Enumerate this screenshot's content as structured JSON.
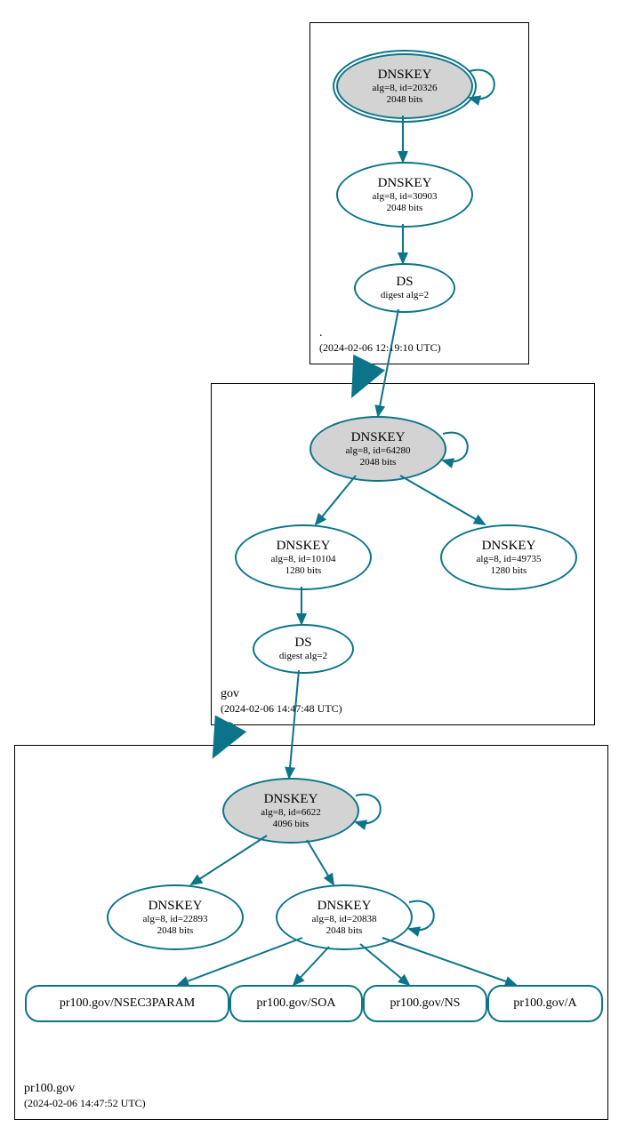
{
  "zones": {
    "root": {
      "name": ".",
      "timestamp": "(2024-02-06 12:19:10 UTC)"
    },
    "gov": {
      "name": "gov",
      "timestamp": "(2024-02-06 14:47:48 UTC)"
    },
    "pr100": {
      "name": "pr100.gov",
      "timestamp": "(2024-02-06 14:47:52 UTC)"
    }
  },
  "nodes": {
    "root_ksk": {
      "title": "DNSKEY",
      "line1": "alg=8, id=20326",
      "line2": "2048 bits"
    },
    "root_zsk": {
      "title": "DNSKEY",
      "line1": "alg=8, id=30903",
      "line2": "2048 bits"
    },
    "root_ds": {
      "title": "DS",
      "line1": "digest alg=2"
    },
    "gov_ksk": {
      "title": "DNSKEY",
      "line1": "alg=8, id=64280",
      "line2": "2048 bits"
    },
    "gov_zsk1": {
      "title": "DNSKEY",
      "line1": "alg=8, id=10104",
      "line2": "1280 bits"
    },
    "gov_zsk2": {
      "title": "DNSKEY",
      "line1": "alg=8, id=49735",
      "line2": "1280 bits"
    },
    "gov_ds": {
      "title": "DS",
      "line1": "digest alg=2"
    },
    "p_ksk": {
      "title": "DNSKEY",
      "line1": "alg=8, id=6622",
      "line2": "4096 bits"
    },
    "p_zsk1": {
      "title": "DNSKEY",
      "line1": "alg=8, id=22893",
      "line2": "2048 bits"
    },
    "p_zsk2": {
      "title": "DNSKEY",
      "line1": "alg=8, id=20838",
      "line2": "2048 bits"
    }
  },
  "records": {
    "nsec3": "pr100.gov/NSEC3PARAM",
    "soa": "pr100.gov/SOA",
    "ns": "pr100.gov/NS",
    "a": "pr100.gov/A"
  }
}
